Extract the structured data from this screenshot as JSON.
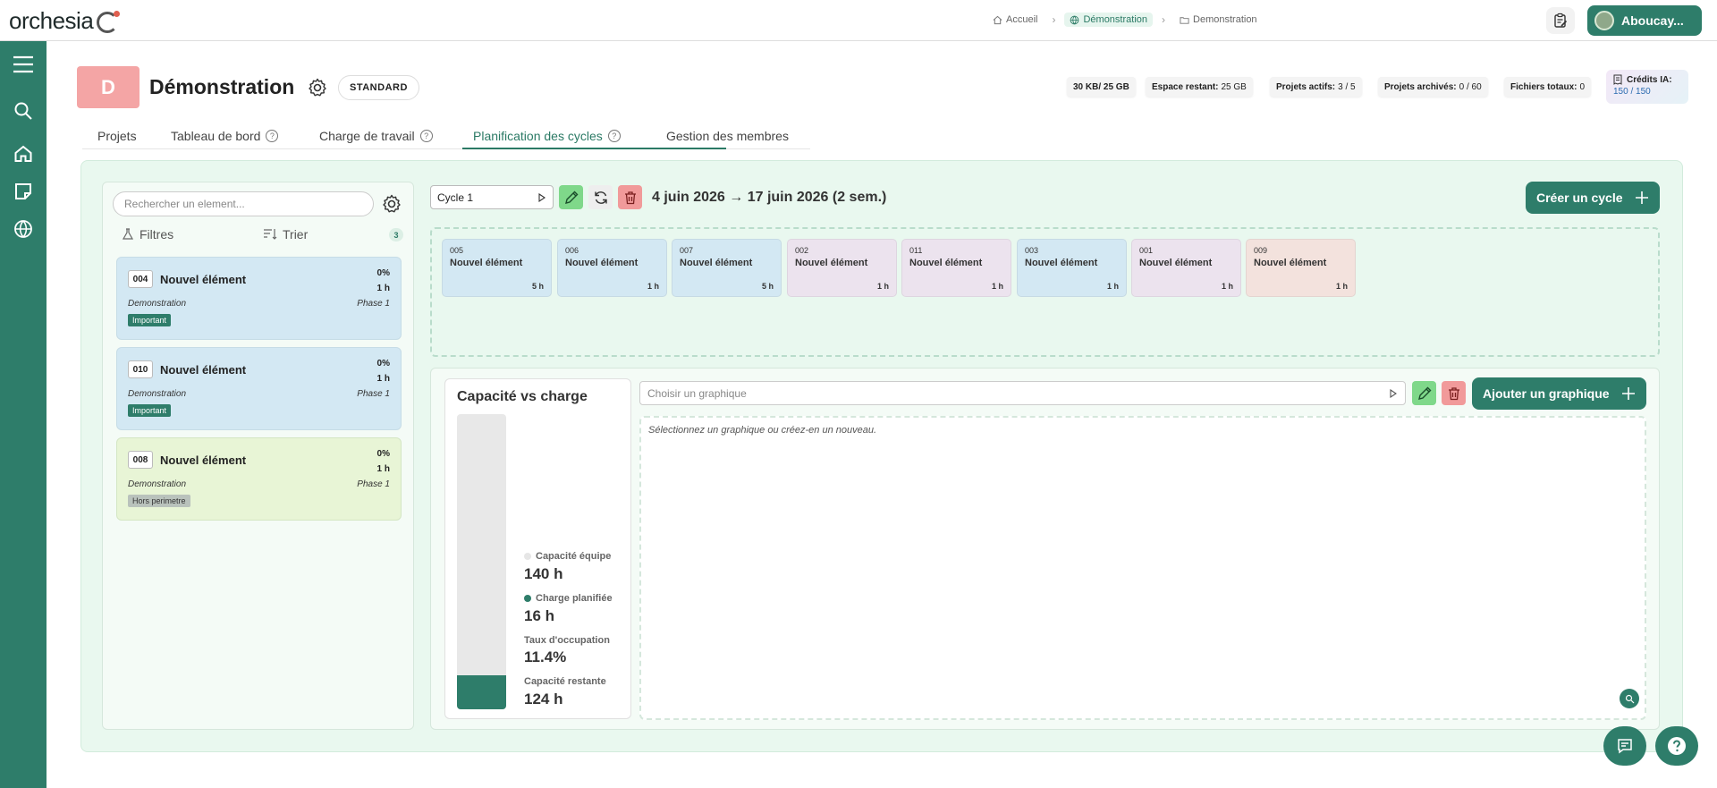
{
  "app": {
    "logo": "orchesia"
  },
  "breadcrumb": {
    "home": "Accueil",
    "workspace": "Démonstration",
    "project": "Demonstration"
  },
  "user": {
    "name": "Aboucay..."
  },
  "project": {
    "badge_letter": "D",
    "title": "Démonstration",
    "plan": "STANDARD",
    "stats": [
      {
        "label": "30 KB/ 25 GB",
        "value": ""
      },
      {
        "label": "Espace restant:",
        "value": "25 GB"
      },
      {
        "label": "Projets actifs:",
        "value": "3 / 5"
      },
      {
        "label": "Projets archivés:",
        "value": "0 / 60"
      },
      {
        "label": "Fichiers totaux:",
        "value": "0"
      }
    ],
    "credits": {
      "label": "Crédits IA:",
      "value": "150 / 150"
    }
  },
  "tabs": [
    "Projets",
    "Tableau de bord",
    "Charge de travail",
    "Planification des cycles",
    "Gestion des membres"
  ],
  "backlog": {
    "search_placeholder": "Rechercher un element...",
    "filters": "Filtres",
    "sort": "Trier",
    "count": "3",
    "items": [
      {
        "code": "004",
        "title": "Nouvel élément",
        "progress": "0%",
        "hours": "1 h",
        "project": "Demonstration",
        "phase": "Phase 1",
        "tag": "Important"
      },
      {
        "code": "010",
        "title": "Nouvel élément",
        "progress": "0%",
        "hours": "1 h",
        "project": "Demonstration",
        "phase": "Phase 1",
        "tag": "Important"
      },
      {
        "code": "008",
        "title": "Nouvel élément",
        "progress": "0%",
        "hours": "1 h",
        "project": "Demonstration",
        "phase": "Phase 1",
        "tag": "Hors perimetre"
      }
    ]
  },
  "cycle": {
    "selected": "Cycle 1",
    "date_range": "4 juin 2026 → 17 juin 2026 (2 sem.)",
    "create_label": "Créer un cycle",
    "items": [
      {
        "code": "005",
        "title": "Nouvel élément",
        "hours": "5 h",
        "color": "#d3e8f3"
      },
      {
        "code": "006",
        "title": "Nouvel élément",
        "hours": "1 h",
        "color": "#d3e8f3"
      },
      {
        "code": "007",
        "title": "Nouvel élément",
        "hours": "5 h",
        "color": "#d3e8f3"
      },
      {
        "code": "002",
        "title": "Nouvel élément",
        "hours": "1 h",
        "color": "#ece3ee"
      },
      {
        "code": "011",
        "title": "Nouvel élément",
        "hours": "1 h",
        "color": "#ece3ee"
      },
      {
        "code": "003",
        "title": "Nouvel élément",
        "hours": "1 h",
        "color": "#d3e8f3"
      },
      {
        "code": "001",
        "title": "Nouvel élément",
        "hours": "1 h",
        "color": "#ece3ee"
      },
      {
        "code": "009",
        "title": "Nouvel élément",
        "hours": "1 h",
        "color": "#f3e2dd"
      }
    ]
  },
  "capacity": {
    "title": "Capacité vs charge",
    "team_capacity_label": "Capacité équipe",
    "team_capacity": "140 h",
    "planned_label": "Charge planifiée",
    "planned": "16 h",
    "occupancy_label": "Taux d'occupation",
    "occupancy": "11.4%",
    "remaining_label": "Capacité restante",
    "remaining": "124 h",
    "fill_fraction": 0.114
  },
  "graph": {
    "placeholder": "Choisir un graphique",
    "add_label": "Ajouter un graphique",
    "hint": "Sélectionnez un graphique ou créez-en un nouveau."
  },
  "colors": {
    "accent": "#2e7d6a",
    "danger": "#f19a9a",
    "edit": "#7fd88a"
  }
}
